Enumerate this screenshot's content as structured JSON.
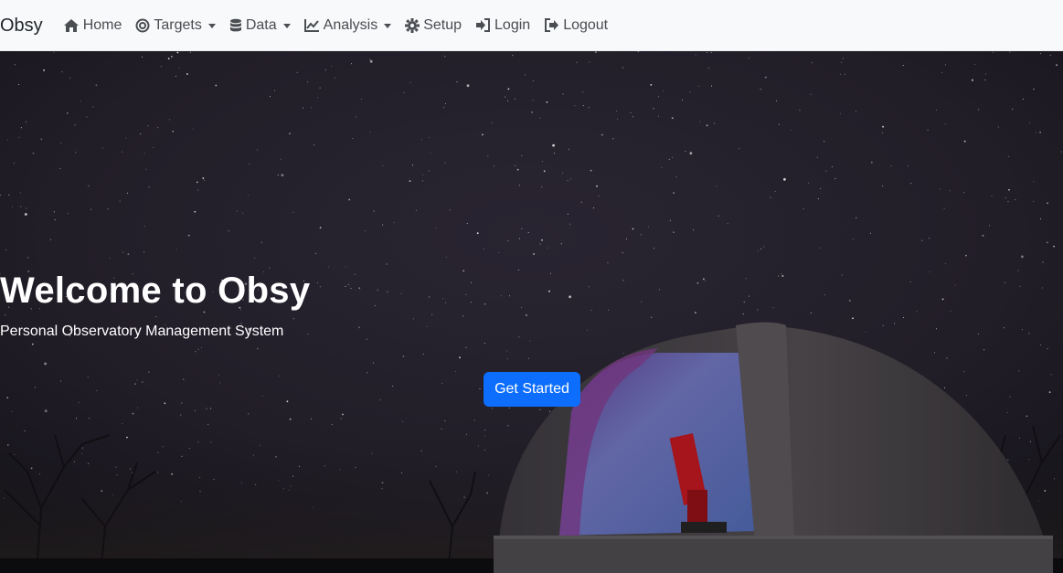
{
  "app": {
    "brand": "Obsy"
  },
  "nav": {
    "items": [
      {
        "label": "Home",
        "icon": "home-icon",
        "dropdown": false
      },
      {
        "label": "Targets",
        "icon": "target-icon",
        "dropdown": true
      },
      {
        "label": "Data",
        "icon": "database-icon",
        "dropdown": true
      },
      {
        "label": "Analysis",
        "icon": "chart-line-icon",
        "dropdown": true
      },
      {
        "label": "Setup",
        "icon": "gear-icon",
        "dropdown": false
      },
      {
        "label": "Login",
        "icon": "sign-in-icon",
        "dropdown": false
      },
      {
        "label": "Logout",
        "icon": "sign-out-icon",
        "dropdown": false
      }
    ]
  },
  "hero": {
    "title": "Welcome to Obsy",
    "subtitle": "Personal Observatory Management System",
    "cta_label": "Get Started"
  },
  "colors": {
    "navbar_bg": "#f8f9fa",
    "primary": "#0d6efd",
    "text": "#4a4d52"
  }
}
